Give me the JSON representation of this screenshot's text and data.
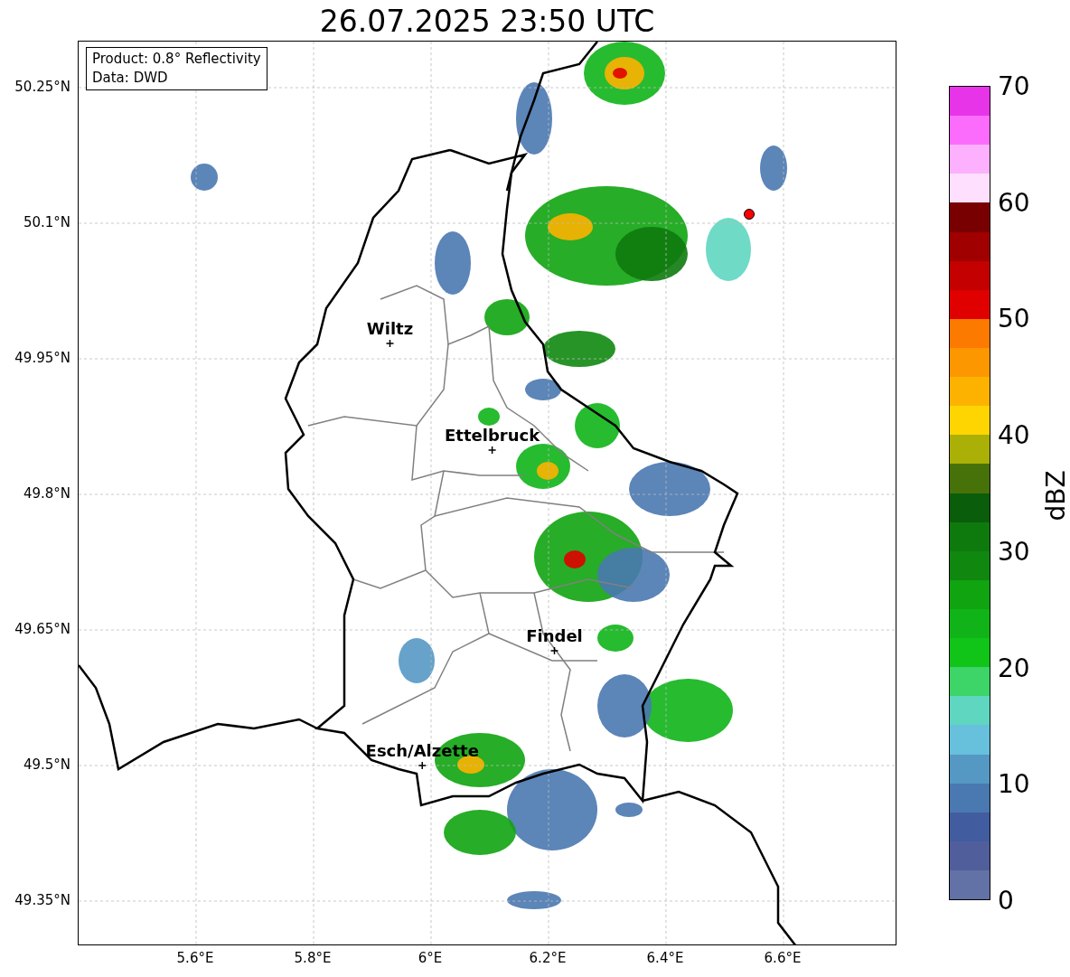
{
  "title": "26.07.2025 23:50 UTC",
  "info_box": [
    "Product: 0.8° Reflectivity",
    "Data: DWD"
  ],
  "yticks": [
    "50.25°N",
    "50.1°N",
    "49.95°N",
    "49.8°N",
    "49.65°N",
    "49.5°N",
    "49.35°N"
  ],
  "xticks": [
    "5.6°E",
    "5.8°E",
    "6°E",
    "6.2°E",
    "6.4°E",
    "6.6°E"
  ],
  "places": [
    "Wiltz",
    "Ettelbruck",
    "Findel",
    "Esch/Alzette"
  ],
  "colorbar": {
    "label": "dBZ",
    "ticks": [
      "70",
      "60",
      "50",
      "40",
      "30",
      "20",
      "10",
      "0"
    ],
    "segments": [
      {
        "color": "#e834e8"
      },
      {
        "color": "#fc6cfc"
      },
      {
        "color": "#fdb0fd"
      },
      {
        "color": "#fee0fe"
      },
      {
        "color": "#780000"
      },
      {
        "color": "#a00000"
      },
      {
        "color": "#c40000"
      },
      {
        "color": "#e00000"
      },
      {
        "color": "#fd7a00"
      },
      {
        "color": "#fd9700"
      },
      {
        "color": "#fdb200"
      },
      {
        "color": "#fed501"
      },
      {
        "color": "#aab005"
      },
      {
        "color": "#47720a"
      },
      {
        "color": "#0a5d0a"
      },
      {
        "color": "#0e7a0e"
      },
      {
        "color": "#108810"
      },
      {
        "color": "#10a410"
      },
      {
        "color": "#10b418"
      },
      {
        "color": "#10c418"
      },
      {
        "color": "#3dd468"
      },
      {
        "color": "#5fd6c0"
      },
      {
        "color": "#67c0dc"
      },
      {
        "color": "#5598c3"
      },
      {
        "color": "#4a78b0"
      },
      {
        "color": "#425d9f"
      },
      {
        "color": "#505f9c"
      },
      {
        "color": "#6272a6"
      }
    ]
  }
}
